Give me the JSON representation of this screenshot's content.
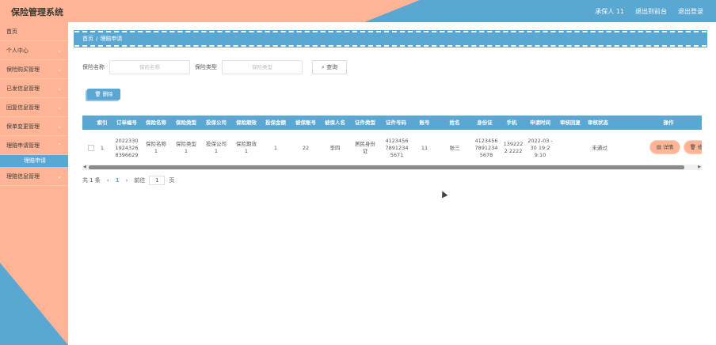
{
  "header": {
    "title": "保险管理系统",
    "user": "承保人 11",
    "to_front": "退出到前台",
    "logout": "退出登录"
  },
  "sidebar": {
    "items": [
      {
        "label": "首页",
        "chevron": false
      },
      {
        "label": "个人中心",
        "chevron": true
      },
      {
        "label": "保险购买管理",
        "chevron": true
      },
      {
        "label": "已发信息管理",
        "chevron": true
      },
      {
        "label": "回复信息管理",
        "chevron": true
      },
      {
        "label": "保单变更管理",
        "chevron": true
      },
      {
        "label": "理赔申请管理",
        "chevron": true
      },
      {
        "label": "理赔申请",
        "sub": true
      },
      {
        "label": "理赔信息管理",
        "chevron": true
      }
    ]
  },
  "breadcrumb": {
    "home": "首页",
    "sep": "/",
    "current": "理赔申请"
  },
  "search": {
    "name_label": "保险名称",
    "name_placeholder": "保险名称",
    "type_label": "保险类型",
    "type_placeholder": "保险类型",
    "query_label": "查询",
    "query_icon": "search-icon"
  },
  "delete_button": {
    "label": "删除",
    "icon": "trash-icon"
  },
  "table": {
    "headers": [
      "",
      "索引",
      "订单编号",
      "保险名称",
      "保险类型",
      "投保公司",
      "保险期效",
      "投保金额",
      "被保账号",
      "被保人名",
      "证件类型",
      "证件号码",
      "账号",
      "姓名",
      "身份证",
      "手机",
      "申请时间",
      "审核回复",
      "审核状态",
      "操作"
    ],
    "rows": [
      [
        "",
        "1",
        "2022330 1924326 8396629",
        "保险名称 1",
        "保险类型 1",
        "投保公司 1",
        "保险期效 1",
        "1",
        "22",
        "李四",
        "居民身份 证",
        "4123456 7891234 5671",
        "11",
        "张三",
        "4123456 7891234 5678",
        "1392222 2222",
        "2022-03 -30 19:2 9:10",
        "",
        "未通过",
        ""
      ]
    ],
    "actions": {
      "detail": "详情",
      "detail_icon": "document-icon",
      "second": "修",
      "second_icon": "trash-icon"
    }
  },
  "pager": {
    "total": "共 1 条",
    "prev": "‹",
    "page": "1",
    "next": "›",
    "goto": "前往",
    "page_input": "1",
    "unit": "页"
  },
  "colors": {
    "blue": "#5aa7d4",
    "peach": "#ffb595"
  }
}
